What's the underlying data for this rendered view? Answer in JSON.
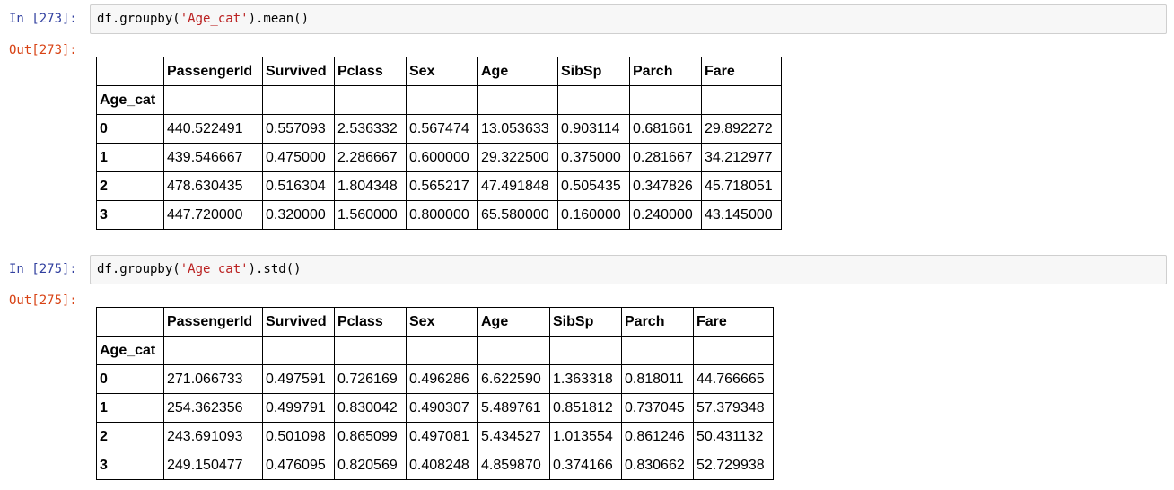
{
  "cells": [
    {
      "in_prompt": "In [273]:",
      "code_prefix": "df.groupby(",
      "code_string": "'Age_cat'",
      "code_suffix": ").mean()",
      "out_prompt": "Out[273]:",
      "table": {
        "columns": [
          "PassengerId",
          "Survived",
          "Pclass",
          "Sex",
          "Age",
          "SibSp",
          "Parch",
          "Fare"
        ],
        "index_name": "Age_cat",
        "rows": [
          {
            "index": "0",
            "values": [
              "440.522491",
              "0.557093",
              "2.536332",
              "0.567474",
              "13.053633",
              "0.903114",
              "0.681661",
              "29.892272"
            ]
          },
          {
            "index": "1",
            "values": [
              "439.546667",
              "0.475000",
              "2.286667",
              "0.600000",
              "29.322500",
              "0.375000",
              "0.281667",
              "34.212977"
            ]
          },
          {
            "index": "2",
            "values": [
              "478.630435",
              "0.516304",
              "1.804348",
              "0.565217",
              "47.491848",
              "0.505435",
              "0.347826",
              "45.718051"
            ]
          },
          {
            "index": "3",
            "values": [
              "447.720000",
              "0.320000",
              "1.560000",
              "0.800000",
              "65.580000",
              "0.160000",
              "0.240000",
              "43.145000"
            ]
          }
        ]
      }
    },
    {
      "in_prompt": "In [275]:",
      "code_prefix": "df.groupby(",
      "code_string": "'Age_cat'",
      "code_suffix": ").std()",
      "out_prompt": "Out[275]:",
      "table": {
        "columns": [
          "PassengerId",
          "Survived",
          "Pclass",
          "Sex",
          "Age",
          "SibSp",
          "Parch",
          "Fare"
        ],
        "index_name": "Age_cat",
        "rows": [
          {
            "index": "0",
            "values": [
              "271.066733",
              "0.497591",
              "0.726169",
              "0.496286",
              "6.622590",
              "1.363318",
              "0.818011",
              "44.766665"
            ]
          },
          {
            "index": "1",
            "values": [
              "254.362356",
              "0.499791",
              "0.830042",
              "0.490307",
              "5.489761",
              "0.851812",
              "0.737045",
              "57.379348"
            ]
          },
          {
            "index": "2",
            "values": [
              "243.691093",
              "0.501098",
              "0.865099",
              "0.497081",
              "5.434527",
              "1.013554",
              "0.861246",
              "50.431132"
            ]
          },
          {
            "index": "3",
            "values": [
              "249.150477",
              "0.476095",
              "0.820569",
              "0.408248",
              "4.859870",
              "0.374166",
              "0.830662",
              "52.729938"
            ]
          }
        ]
      }
    }
  ]
}
